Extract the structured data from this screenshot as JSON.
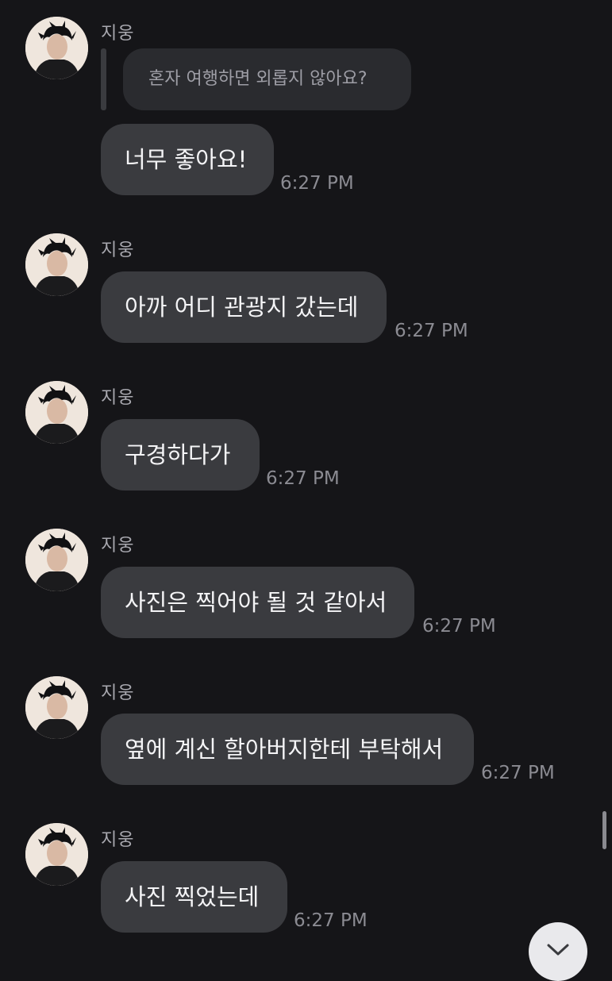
{
  "reply_preview": "혼자 여행하면 외롭지 않아요?",
  "messages": [
    {
      "sender": "지웅",
      "text": "너무 좋아요!",
      "time": "6:27 PM"
    },
    {
      "sender": "지웅",
      "text": "아까 어디 관광지 갔는데",
      "time": "6:27 PM"
    },
    {
      "sender": "지웅",
      "text": "구경하다가",
      "time": "6:27 PM"
    },
    {
      "sender": "지웅",
      "text": "사진은 찍어야 될 것 같아서",
      "time": "6:27 PM"
    },
    {
      "sender": "지웅",
      "text": "옆에 계신 할아버지한테 부탁해서",
      "time": "6:27 PM"
    },
    {
      "sender": "지웅",
      "text": "사진 찍었는데",
      "time": "6:27 PM"
    }
  ],
  "icons": {
    "avatar": "profile-photo",
    "scroll_down": "chevron-down-icon"
  },
  "colors": {
    "background": "#151518",
    "bubble": "#3a3b3f",
    "reply_bubble": "#2a2b2f",
    "sender": "#a9a9b0",
    "time": "#8b8b92"
  }
}
